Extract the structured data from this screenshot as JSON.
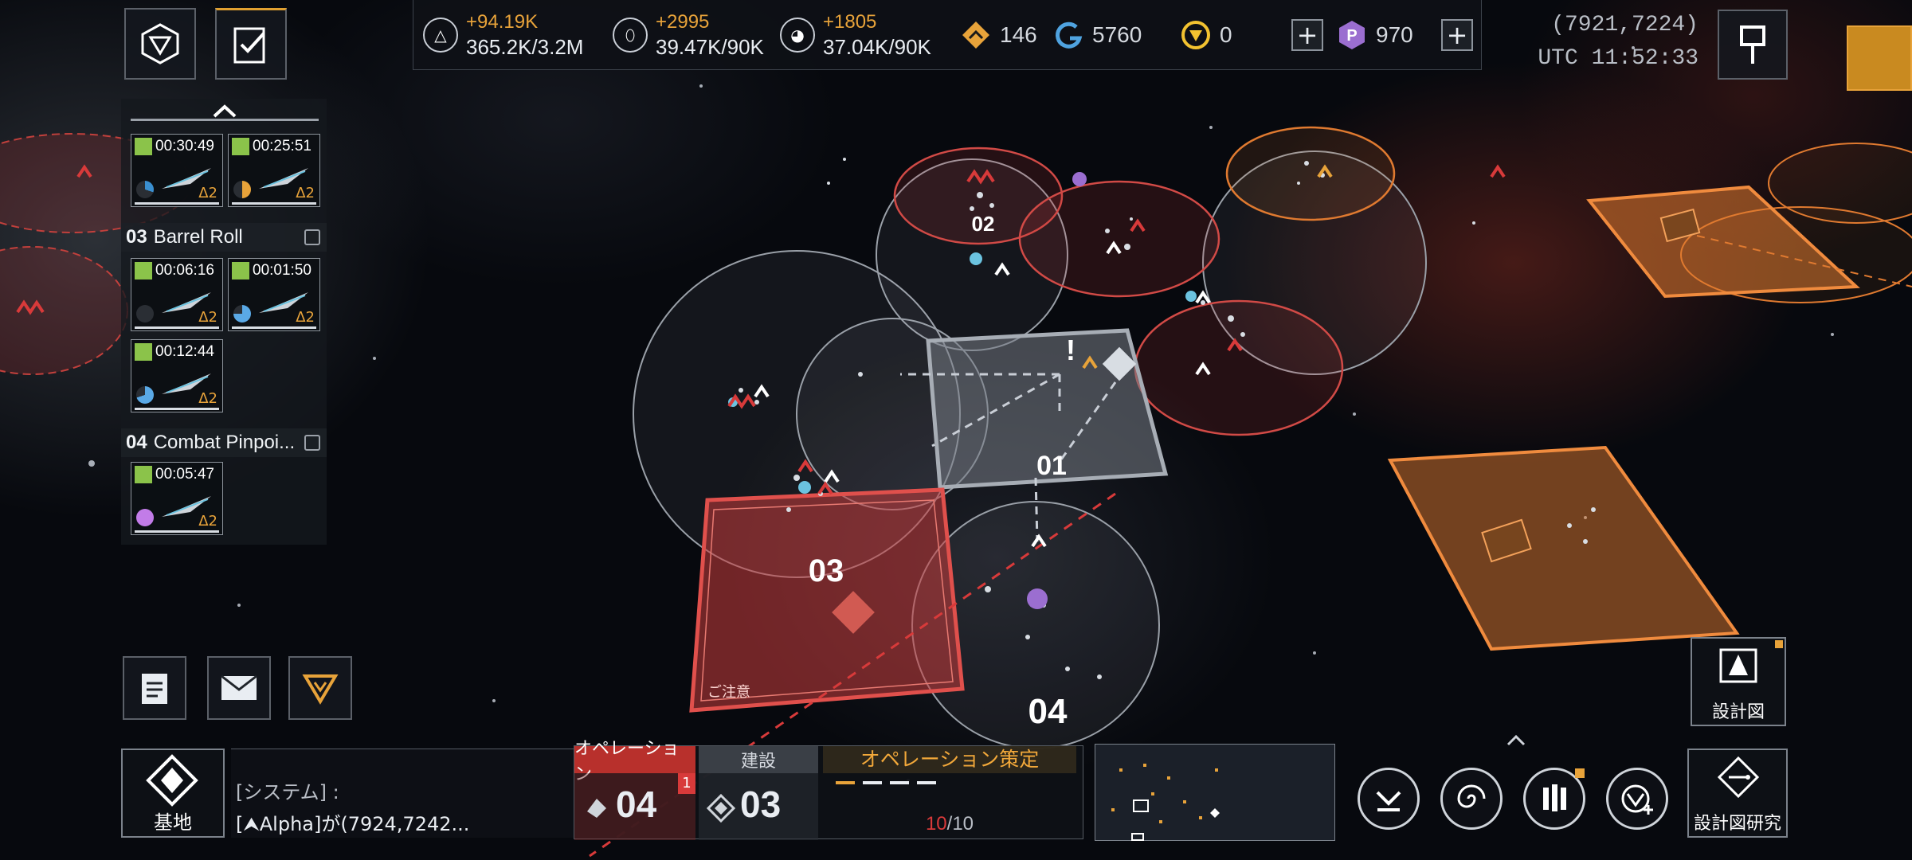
{
  "resources": {
    "r1": {
      "gain": "+94.19K",
      "amount": "365.2K/3.2M"
    },
    "r2": {
      "gain": "+2995",
      "amount": "39.47K/90K"
    },
    "r3": {
      "gain": "+1805",
      "amount": "37.04K/90K"
    }
  },
  "currencies": {
    "rank": "146",
    "credits": "5760",
    "gold": "0",
    "premium": "970"
  },
  "location": {
    "coords": "(7921,7224)",
    "utc": "UTC 11:52:33"
  },
  "fleets": {
    "group_a": [
      {
        "timer": "00:30:49",
        "tier": "Δ2",
        "pie_color": "#3a8fd0"
      },
      {
        "timer": "00:25:51",
        "tier": "Δ2",
        "pie_color": "#e8a33a"
      }
    ],
    "group_03": {
      "number": "03",
      "name": "Barrel Roll",
      "slots": [
        {
          "timer": "00:06:16",
          "tier": "Δ2",
          "pie_color": "#2a2e34"
        },
        {
          "timer": "00:01:50",
          "tier": "Δ2",
          "pie_color": "#5aa9e6"
        },
        {
          "timer": "00:12:44",
          "tier": "Δ2",
          "pie_color": "#5aa9e6"
        }
      ]
    },
    "group_04": {
      "number": "04",
      "name": "Combat Pinpoi...",
      "slots": [
        {
          "timer": "00:05:47",
          "tier": "Δ2",
          "pie_color": "#c27ce8"
        }
      ]
    }
  },
  "map_labels": {
    "zone_01": "01",
    "zone_02": "02",
    "zone_03": "03",
    "zone_04": "04",
    "caution": "ご注意"
  },
  "bottom": {
    "base_label": "基地",
    "chat_line1": "[システム] :",
    "chat_line2": "[⮝Alpha]が(7924,7242...",
    "tab_operation": "オペレーション",
    "tab_build": "建設",
    "operation_badge": "1",
    "operation_count": "04",
    "build_count": "03",
    "plan_title": "オペレーション策定",
    "plan_current": "10",
    "plan_max": "/10",
    "blueprint_label": "設計図",
    "blueprint_research_label": "設計図研究"
  },
  "colors": {
    "accent_orange": "#e8a33a",
    "hostile_red": "#d83a3a",
    "territory_orange": "#e07a30"
  }
}
